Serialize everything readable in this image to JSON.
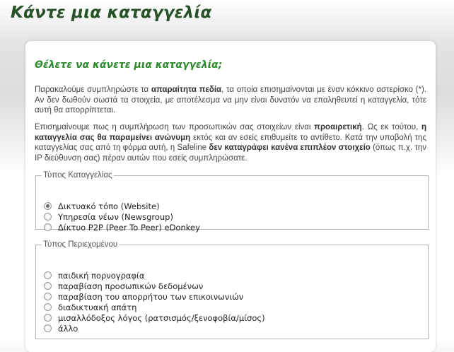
{
  "page": {
    "title": "Κάντε μια καταγγελία"
  },
  "form": {
    "heading": "Θέλετε να κάνετε μια καταγγελία;",
    "intro": {
      "t1": "Παρακαλούμε συμπληρώστε τα ",
      "b1": "απαραίτητα πεδία",
      "t2": ", τα οποία επισημαίνονται με έναν κόκκινο αστερίσκο (*). Αν δεν δωθούν σωστά τα στοιχεία, με αποτέλεσμα να μην είναι δυνατόν να επαληθευτεί η καταγγελία, τότε αυτή θα απορρίπτεται."
    },
    "privacy": {
      "t1": "Επισημαίνουμε πως η συμπλήρωση των προσωπικών σας στοιχείων είναι ",
      "b1": "προαιρετική",
      "t2": ". Ως εκ τούτου, ",
      "b2": "η καταγγελία σας θα παραμείνει ανώνυμη",
      "t3": " εκτός και αν εσείς επιθυμείτε το αντίθετο. Κατά την υποβολή της καταγγελίας σας από τη φόρμα αυτή, η Safeline ",
      "b3": "δεν καταγράφει κανένα επιπλέον στοιχείο",
      "t4": " (όπως π.χ. την IP διεύθυνση σας) πέραν αυτών που εσείς συμπληρώσατε."
    },
    "report_type": {
      "legend": "Τύπος Καταγγελίας",
      "options": [
        {
          "label": "Δικτυακό τόπο (Website)",
          "checked": true
        },
        {
          "label": "Υπηρεσία νέων (Newsgroup)",
          "checked": false
        },
        {
          "label": "Δίκτυο P2P (Peer To Peer) eDonkey",
          "checked": false
        }
      ]
    },
    "content_type": {
      "legend": "Τύπος Περιεχομένου",
      "options": [
        {
          "label": "παιδική πορνογραφία",
          "checked": false
        },
        {
          "label": "παραβίαση προσωπικών δεδομένων",
          "checked": false
        },
        {
          "label": "παραβίαση του απορρήτου των επικοινωνιών",
          "checked": false
        },
        {
          "label": "διαδικτυακή απάτη",
          "checked": false
        },
        {
          "label": "μισαλλόδοξος λόγος (ρατσισμός/ξενοφοβία/μίσος)",
          "checked": false
        },
        {
          "label": "άλλο",
          "checked": false
        }
      ]
    }
  }
}
